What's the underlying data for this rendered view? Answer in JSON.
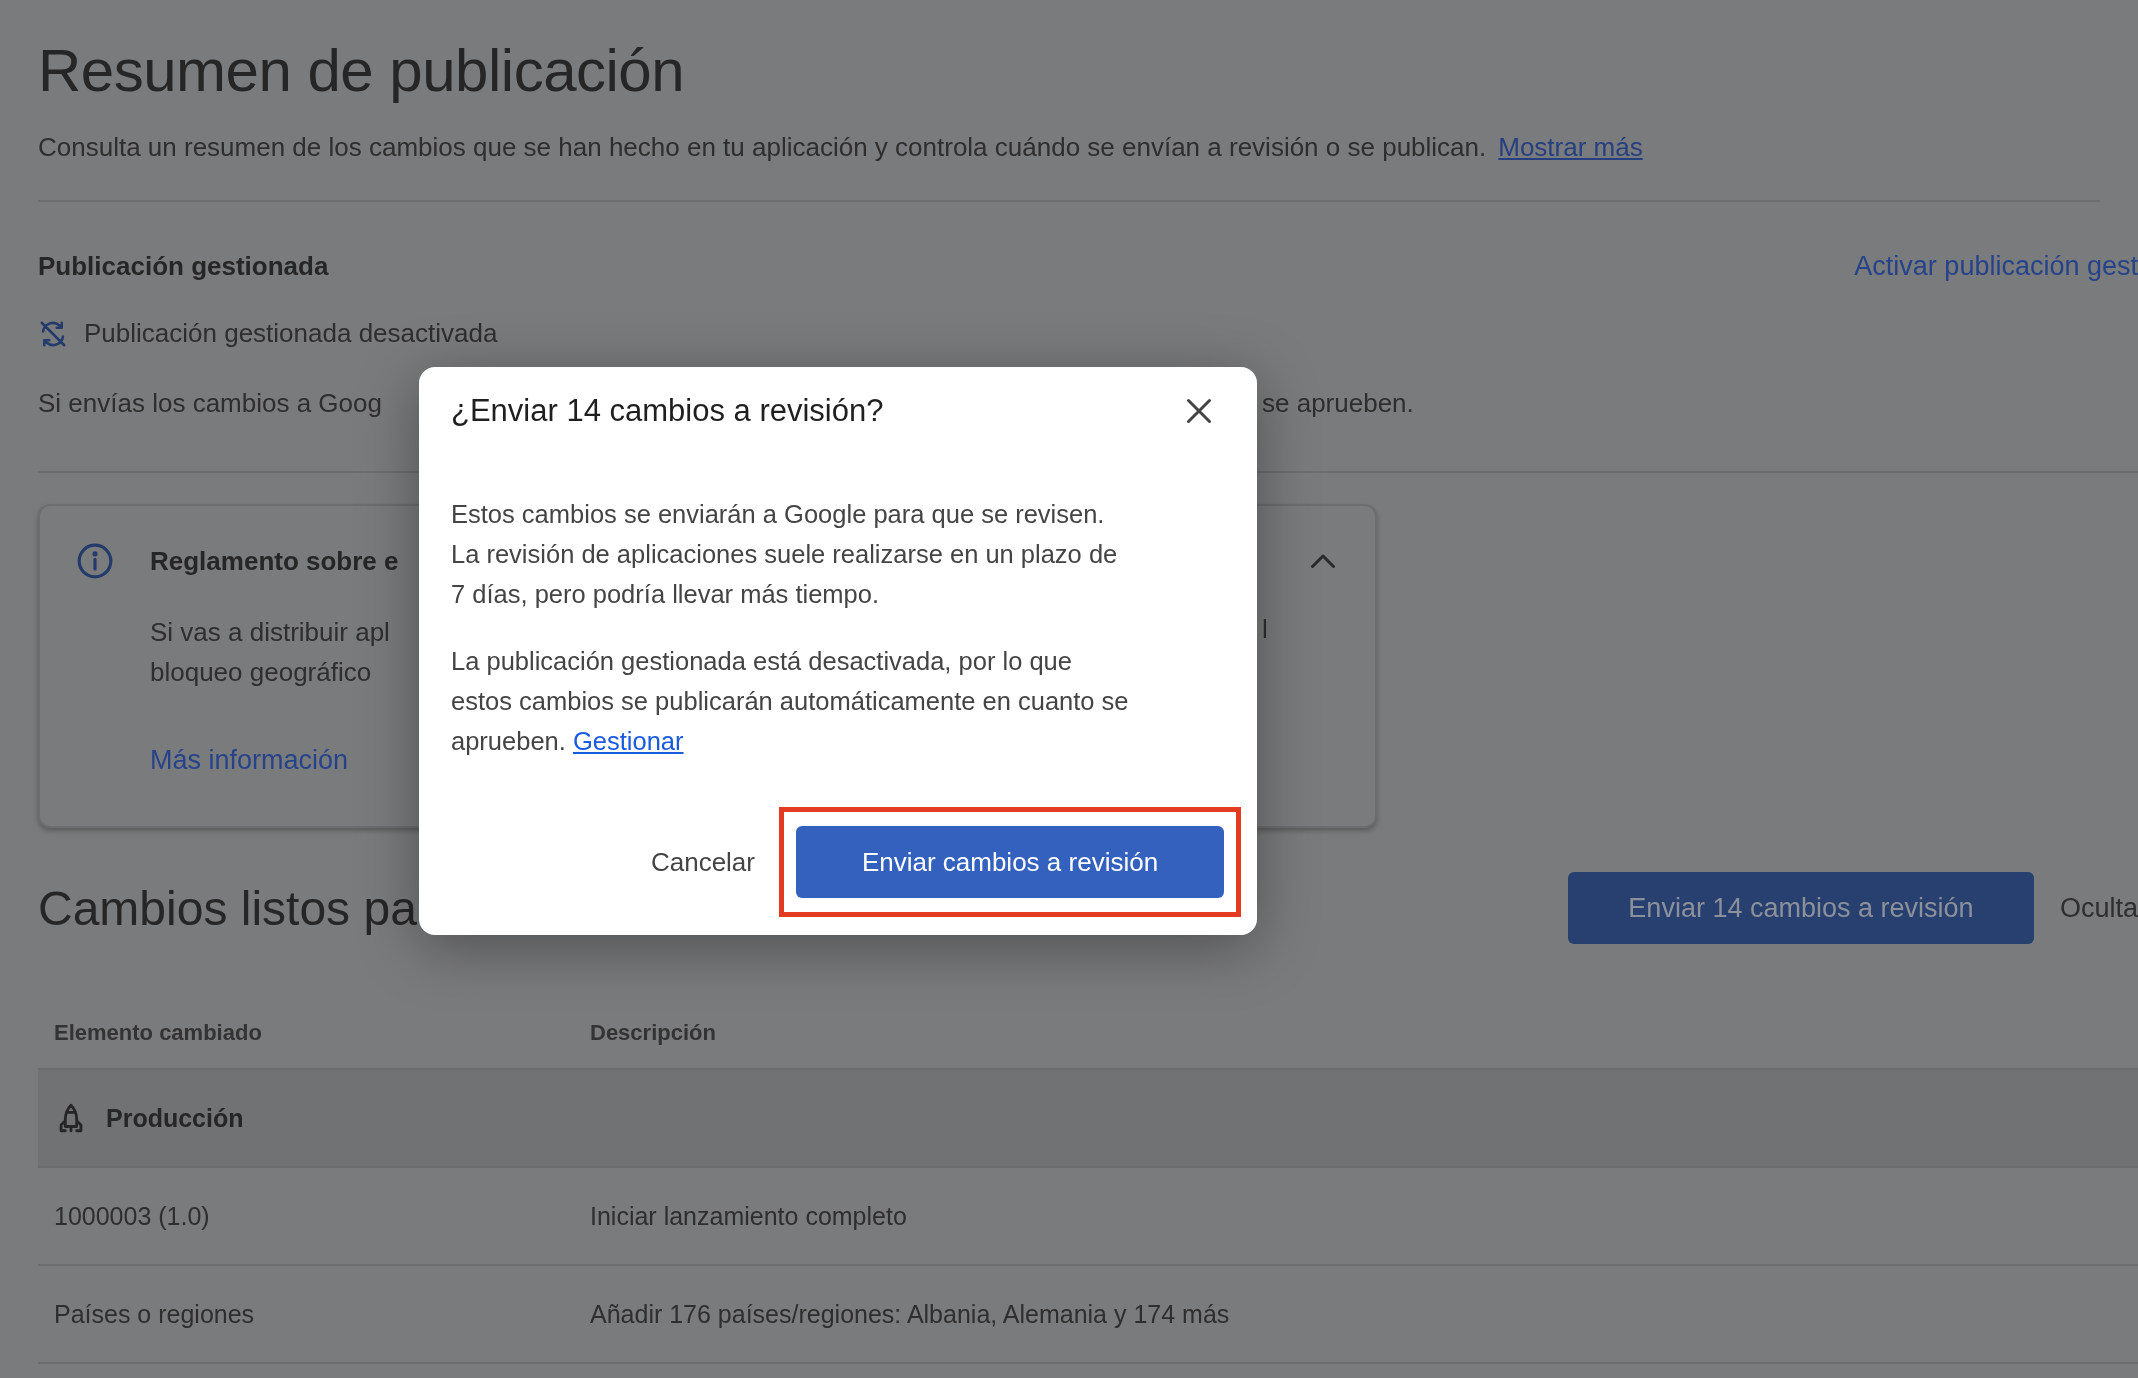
{
  "page": {
    "title": "Resumen de publicación",
    "description": "Consulta un resumen de los cambios que se han hecho en tu aplicación y controla cuándo se envían a revisión o se publican.",
    "description_link": "Mostrar más"
  },
  "managed_publishing": {
    "heading": "Publicación gestionada",
    "action_link": "Activar publicación gest",
    "status": "Publicación gestionada desactivada",
    "note_visible_start": "Si envías los cambios a Goog",
    "note_visible_end": "se aprueben."
  },
  "policy_card": {
    "title": "Reglamento sobre e",
    "expanded": true,
    "body_visible_start": [
      "Si vas a distribuir apl",
      "bloqueo geográfico"
    ],
    "body_visible_end": "l",
    "link": "Más información"
  },
  "changes": {
    "heading": "Cambios listos pa",
    "submit_button": "Enviar 14 cambios a revisión",
    "hide_link": "Oculta",
    "columns": [
      "Elemento cambiado",
      "Descripción"
    ],
    "group": "Producción",
    "rows": [
      {
        "item": "1000003 (1.0)",
        "description": "Iniciar lanzamiento completo"
      },
      {
        "item": "Países o regiones",
        "description": "Añadir 176 países/regiones: Albania, Alemania y 174 más"
      }
    ]
  },
  "dialog": {
    "title": "¿Enviar 14 cambios a revisión?",
    "paragraphs": [
      {
        "text": "Estos cambios se enviarán a Google para que se revisen. La revisión de aplicaciones suele realizarse en un plazo de 7 días, pero podría llevar más tiempo."
      },
      {
        "text": "La publicación gestionada está desactivada, por lo que estos cambios se publicarán automáticamente en cuanto se aprueben.",
        "link": "Gestionar"
      }
    ],
    "cancel": "Cancelar",
    "confirm": "Enviar cambios a revisión",
    "confirm_highlighted": true
  }
}
